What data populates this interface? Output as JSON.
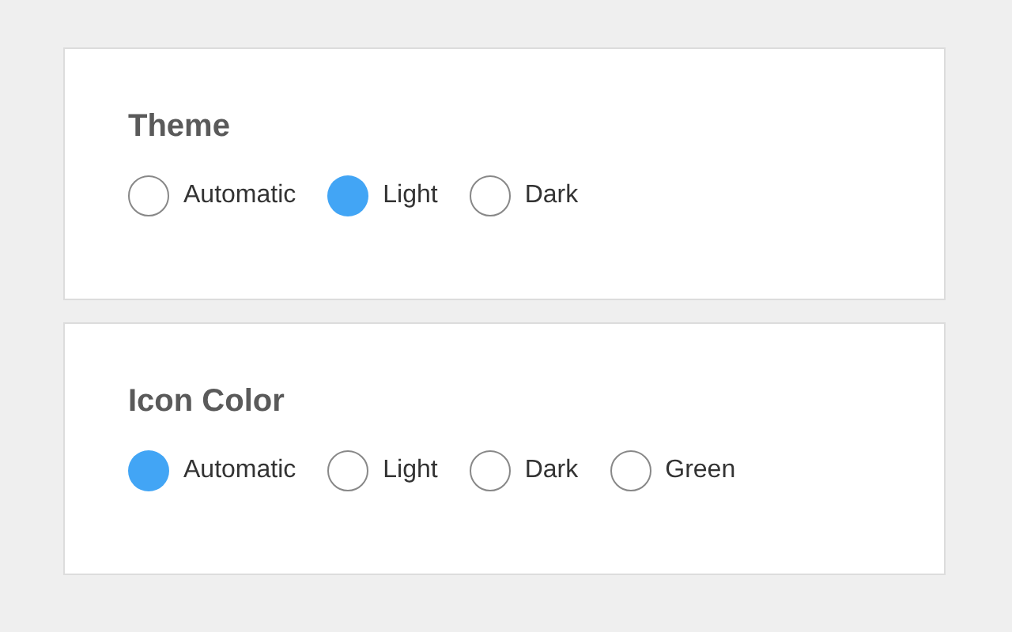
{
  "sections": [
    {
      "title": "Theme",
      "options": [
        {
          "label": "Automatic",
          "selected": false
        },
        {
          "label": "Light",
          "selected": true
        },
        {
          "label": "Dark",
          "selected": false
        }
      ]
    },
    {
      "title": "Icon Color",
      "options": [
        {
          "label": "Automatic",
          "selected": true
        },
        {
          "label": "Light",
          "selected": false
        },
        {
          "label": "Dark",
          "selected": false
        },
        {
          "label": "Green",
          "selected": false
        }
      ]
    }
  ]
}
